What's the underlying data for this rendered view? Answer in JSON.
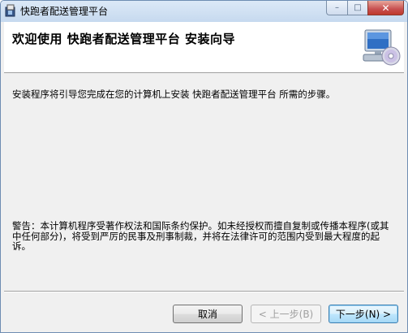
{
  "window": {
    "title": "快跑者配送管理平台"
  },
  "banner": {
    "title": "欢迎使用 快跑者配送管理平台 安装向导",
    "icon": "computer-cd-icon"
  },
  "body": {
    "intro": "安装程序将引导您完成在您的计算机上安装 快跑者配送管理平台 所需的步骤。",
    "warning": "警告：本计算机程序受著作权法和国际条约保护。如未经授权而擅自复制或传播本程序(或其中任何部分)，将受到严厉的民事及刑事制裁，并将在法律许可的范围内受到最大程度的起诉。"
  },
  "buttons": {
    "cancel": "取消",
    "back": "< 上一步(B)",
    "next": "下一步(N) >"
  },
  "controls": {
    "minimize": "–",
    "maximize": "□",
    "close": "✕"
  }
}
